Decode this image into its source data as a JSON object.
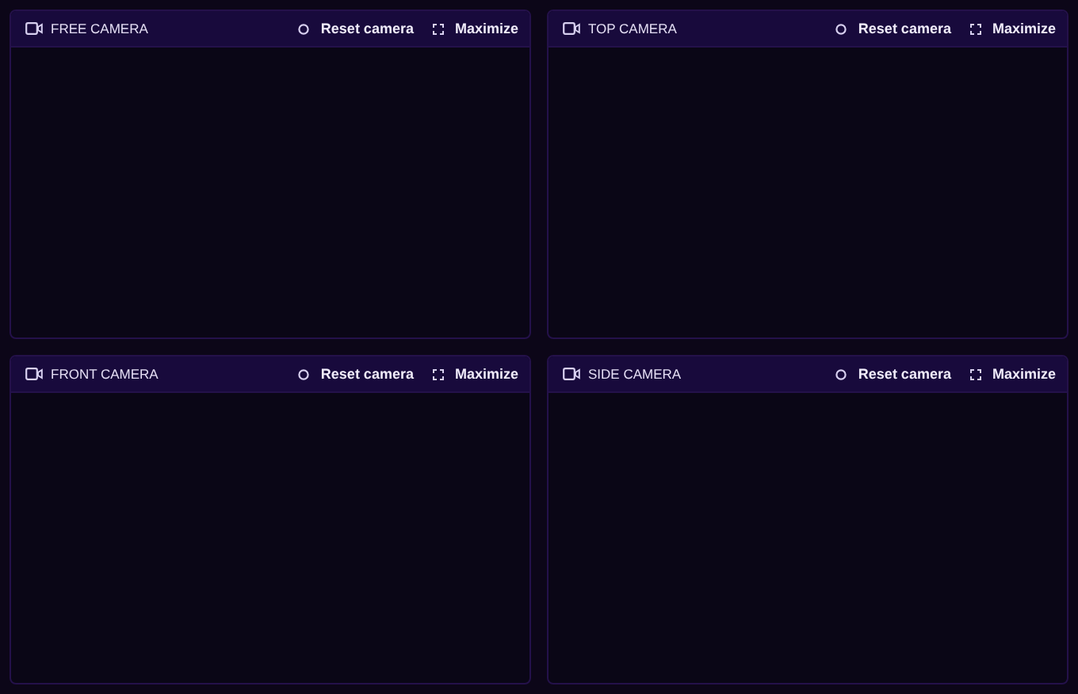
{
  "viewports": [
    {
      "title": "FREE CAMERA",
      "reset_label": "Reset camera",
      "maximize_label": "Maximize"
    },
    {
      "title": "TOP CAMERA",
      "reset_label": "Reset camera",
      "maximize_label": "Maximize"
    },
    {
      "title": "FRONT CAMERA",
      "reset_label": "Reset camera",
      "maximize_label": "Maximize"
    },
    {
      "title": "SIDE CAMERA",
      "reset_label": "Reset camera",
      "maximize_label": "Maximize"
    }
  ]
}
